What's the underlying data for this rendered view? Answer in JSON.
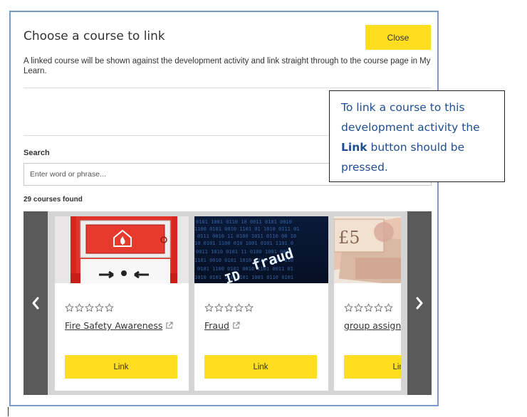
{
  "modal": {
    "title": "Choose a course to link",
    "close_label": "Close",
    "description": "A linked course will be shown against the development activity and link straight through to the course page in My Learn."
  },
  "search": {
    "label": "Search",
    "placeholder": "Enter word or phrase..."
  },
  "results": {
    "count_text": "29 courses found"
  },
  "courses": [
    {
      "title": "Fire Safety Awareness",
      "rating": 0,
      "link_label": "Link",
      "image": "fire-alarm-call-point"
    },
    {
      "title": "Fraud",
      "rating": 0,
      "link_label": "Link",
      "image": "id-fraud-binary"
    },
    {
      "title": "group assignment",
      "rating": 0,
      "link_label": "Link",
      "image": "banknotes"
    }
  ],
  "callout": {
    "text_before": "To link a course to this development activity the ",
    "bold_word": "Link",
    "text_after": " button should be pressed."
  },
  "colors": {
    "accent_yellow": "#ffde21",
    "carousel_arrow": "#5a5a5a",
    "callout_text": "#1f4e90",
    "modal_border": "#7a9bd0"
  },
  "icons": [
    "chevron-left-icon",
    "chevron-right-icon",
    "star-outline-icon",
    "external-link-icon"
  ]
}
